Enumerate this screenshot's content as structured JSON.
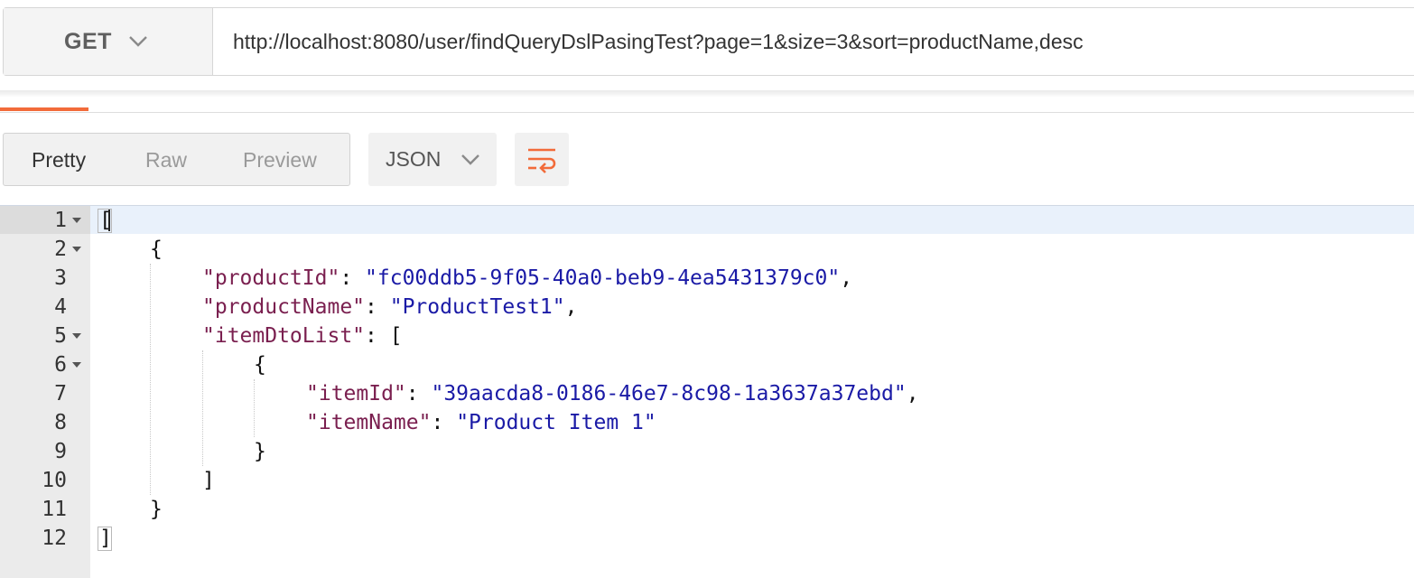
{
  "request": {
    "method": "GET",
    "url": "http://localhost:8080/user/findQueryDslPasingTest?page=1&size=3&sort=productName,desc"
  },
  "toolbar": {
    "views": [
      "Pretty",
      "Raw",
      "Preview"
    ],
    "active_view": "Pretty",
    "format": "JSON",
    "wrap_icon": "wrap-lines-icon"
  },
  "colors": {
    "accent": "#f26b3a",
    "json_key": "#7a1f4f",
    "json_string": "#1a1aa6"
  },
  "editor": {
    "lines": [
      {
        "num": "1",
        "text": "["
      },
      {
        "num": "2",
        "text": "{"
      },
      {
        "num": "3",
        "key": "\"productId\"",
        "value": "\"fc00ddb5-9f05-40a0-beb9-4ea5431379c0\""
      },
      {
        "num": "4",
        "key": "\"productName\"",
        "value": "\"ProductTest1\""
      },
      {
        "num": "5",
        "key": "\"itemDtoList\"",
        "value": "["
      },
      {
        "num": "6",
        "text": "{"
      },
      {
        "num": "7",
        "key": "\"itemId\"",
        "value": "\"39aacda8-0186-46e7-8c98-1a3637a37ebd\""
      },
      {
        "num": "8",
        "key": "\"itemName\"",
        "value": "\"Product Item 1\""
      },
      {
        "num": "9",
        "text": "}"
      },
      {
        "num": "10",
        "text": "]"
      },
      {
        "num": "11",
        "text": "}"
      },
      {
        "num": "12",
        "text": "]"
      }
    ]
  }
}
